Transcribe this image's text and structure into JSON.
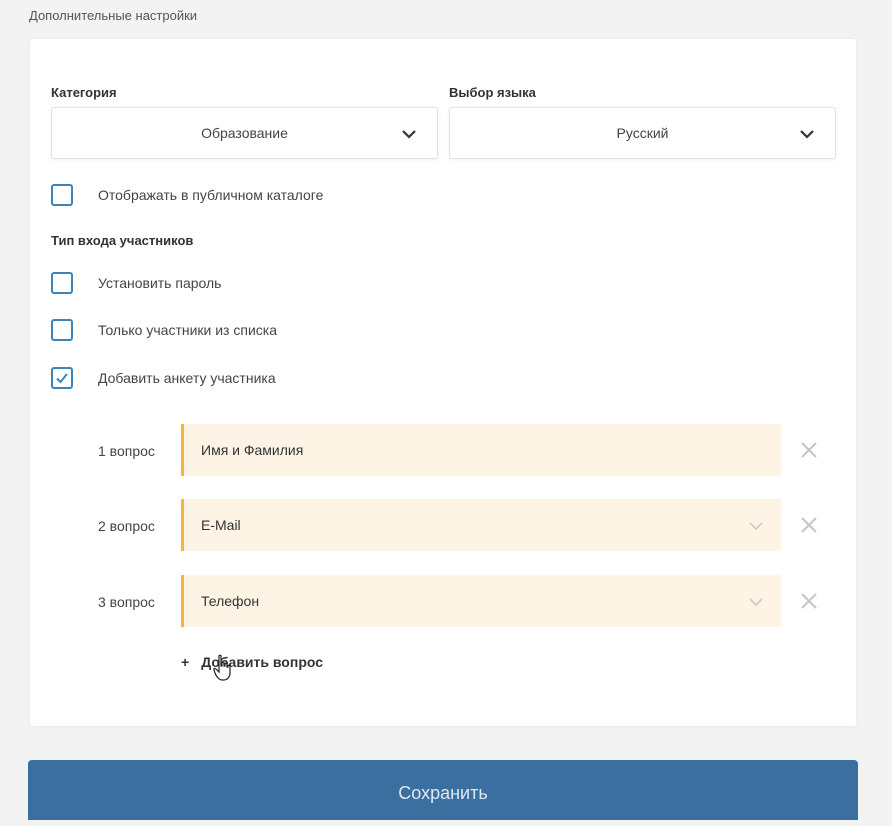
{
  "section_title": "Дополнительные настройки",
  "category": {
    "label": "Категория",
    "value": "Образование"
  },
  "language": {
    "label": "Выбор языка",
    "value": "Русский"
  },
  "public_catalog": {
    "label": "Отображать в публичном каталоге",
    "checked": false
  },
  "entry_type": {
    "title": "Тип входа участников",
    "options": [
      {
        "label": "Установить пароль",
        "checked": false
      },
      {
        "label": "Только участники из списка",
        "checked": false
      },
      {
        "label": "Добавить анкету участника",
        "checked": true
      }
    ]
  },
  "questions": [
    {
      "label": "1 вопрос",
      "value": "Имя и Фамилия",
      "has_dropdown": false
    },
    {
      "label": "2 вопрос",
      "value": "E-Mail",
      "has_dropdown": true
    },
    {
      "label": "3 вопрос",
      "value": "Телефон",
      "has_dropdown": true
    }
  ],
  "add_question": {
    "plus": "+",
    "label": "Добавить вопрос"
  },
  "save_button": "Сохранить",
  "colors": {
    "accent_blue": "#3d84b8",
    "question_border": "#f4b633",
    "question_bg": "#fdf4e6",
    "save_bg": "#3b6fa0"
  }
}
